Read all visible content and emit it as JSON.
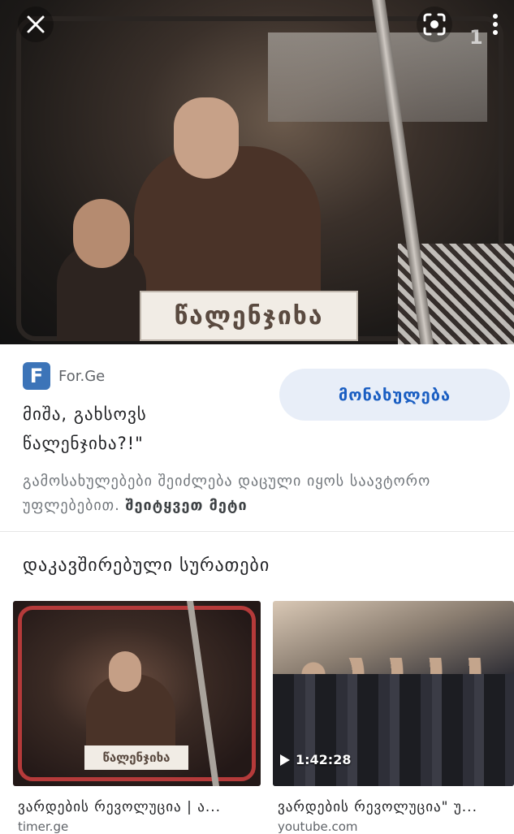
{
  "viewer": {
    "close_icon": "close-icon",
    "lens_icon": "google-lens-icon",
    "more_icon": "more-vert-icon",
    "watermark": "1",
    "sign_text": "წალენჯიხა"
  },
  "result": {
    "source": "For.Ge",
    "favicon_letter": "F",
    "favicon_color": "#3c74b8",
    "title": "მიშა, გახსოვს წალენჯიხა?!\"",
    "visit_label": "მონახულება",
    "copyright_text": "გამოსახულებები შეიძლება დაცული იყოს საავტორო უფლებებით.",
    "learn_more": "შეიტყვეთ მეტი"
  },
  "related": {
    "heading": "დაკავშირებული სურათები",
    "items": [
      {
        "caption": "ვარდების რევოლუცია | ა...",
        "source": "timer.ge",
        "sign_text": "წალენჯიხა"
      },
      {
        "caption": "ვარდების რევოლუცია\" უ...",
        "source": "youtube.com",
        "duration": "1:42:28"
      }
    ]
  },
  "colors": {
    "accent": "#1a5ec2",
    "button_bg": "#e8eef8"
  }
}
